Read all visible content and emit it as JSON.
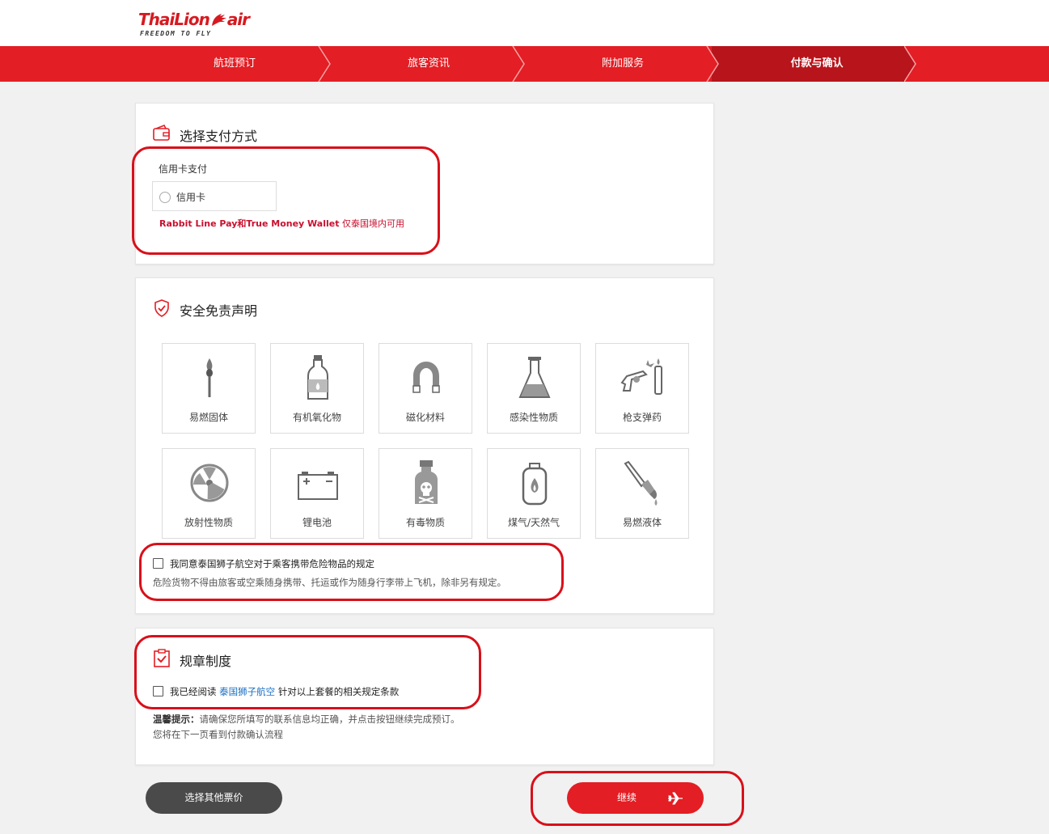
{
  "brand": {
    "name": "ThaiLion",
    "name_suffix": "air",
    "tagline": "FREEDOM TO FLY",
    "color": "#d71920"
  },
  "steps": [
    {
      "label": "航班预订",
      "active": false
    },
    {
      "label": "旅客资讯",
      "active": false
    },
    {
      "label": "附加服务",
      "active": false
    },
    {
      "label": "付款与确认",
      "active": true
    }
  ],
  "payment": {
    "title": "选择支付方式",
    "group_label": "信用卡支付",
    "option_label": "信用卡",
    "option_selected": false,
    "note_bold": "Rabbit Line Pay和True Money Wallet",
    "note_rest": " 仅泰国境内可用"
  },
  "safety": {
    "title": "安全免责声明",
    "items": [
      {
        "label": "易燃固体",
        "icon": "match-icon"
      },
      {
        "label": "有机氧化物",
        "icon": "bottle-icon"
      },
      {
        "label": "磁化材料",
        "icon": "magnet-icon"
      },
      {
        "label": "感染性物质",
        "icon": "flask-icon"
      },
      {
        "label": "枪支弹药",
        "icon": "gun-ammo-icon"
      },
      {
        "label": "放射性物质",
        "icon": "radiation-icon"
      },
      {
        "label": "锂电池",
        "icon": "battery-icon"
      },
      {
        "label": "有毒物质",
        "icon": "poison-icon"
      },
      {
        "label": "煤气/天然气",
        "icon": "gas-cylinder-icon"
      },
      {
        "label": "易燃液体",
        "icon": "paint-brush-icon"
      }
    ],
    "agree_label": "我同意泰国狮子航空对于乘客携带危险物品的规定",
    "agree_checked": false,
    "disclaimer": "危险货物不得由旅客或空乘随身携带、托运或作为随身行李带上飞机，除非另有规定。"
  },
  "rules": {
    "title": "规章制度",
    "read_prefix": "我已经阅读",
    "read_link": "泰国狮子航空",
    "read_suffix": "针对以上套餐的相关规定条款",
    "read_checked": false,
    "tip_label": "温馨提示：",
    "tip_text": "请确保您所填写的联系信息均正确，并点击按钮继续完成预订。",
    "next_page_text": "您将在下一页看到付款确认流程"
  },
  "buttons": {
    "other_fare": "选择其他票价",
    "continue": "继续"
  },
  "colors": {
    "accent": "#e31e24",
    "active_step": "#b7141b",
    "highlight": "#d8101a",
    "link": "#1a6fc4"
  }
}
